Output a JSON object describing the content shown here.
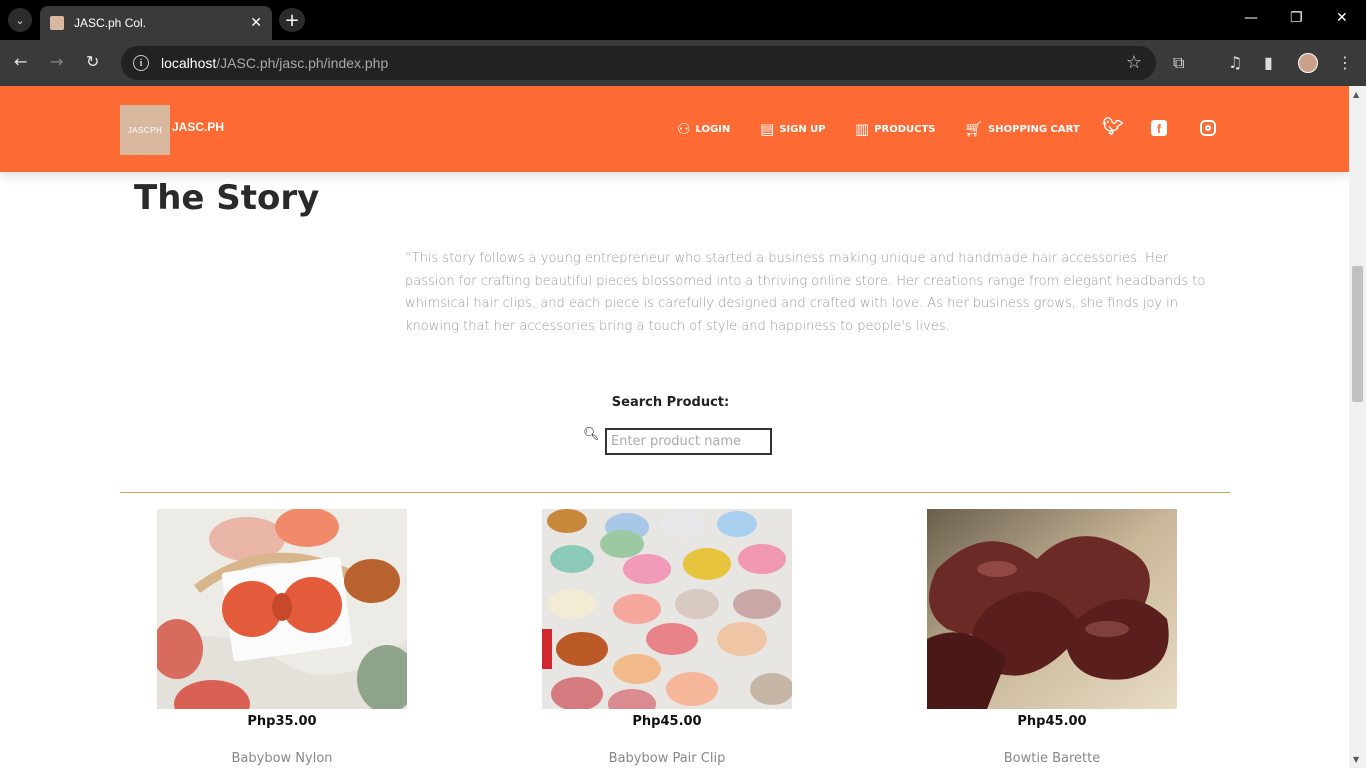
{
  "browser": {
    "tab_title": "JASC.ph Col.",
    "tab_close": "✕",
    "new_tab": "+",
    "url_host": "localhost",
    "url_path": "/JASC.ph/jasc.ph/index.php"
  },
  "header": {
    "logo_text": "JASCPH",
    "brand": "JASC.PH",
    "nav": [
      {
        "label": "LOGIN",
        "icon": "user-icon"
      },
      {
        "label": "SIGN UP",
        "icon": "signup-icon"
      },
      {
        "label": "PRODUCTS",
        "icon": "products-icon"
      },
      {
        "label": "SHOPPING CART",
        "icon": "cart-icon"
      }
    ],
    "social": [
      "twitter-icon",
      "facebook-icon",
      "instagram-icon"
    ]
  },
  "story": {
    "title": "The Story",
    "text": "“This story follows a young entrepreneur who started a business making unique and handmade hair accessories. Her passion for crafting beautiful pieces blossomed into a thriving online store. Her creations range from elegant headbands to whimsical hair clips, and each piece is carefully designed and crafted with love. As her business grows, she finds joy in knowing that her accessories bring a touch of style and happiness to people's lives."
  },
  "search": {
    "label": "Search Product:",
    "placeholder": "Enter product name"
  },
  "products": [
    {
      "price": "Php35.00",
      "name": "Babybow Nylon"
    },
    {
      "price": "Php45.00",
      "name": "Babybow Pair Clip"
    },
    {
      "price": "Php45.00",
      "name": "Bowtie Barette"
    }
  ],
  "colors": {
    "accent": "#fd6a33",
    "divider": "#d4a24a"
  }
}
